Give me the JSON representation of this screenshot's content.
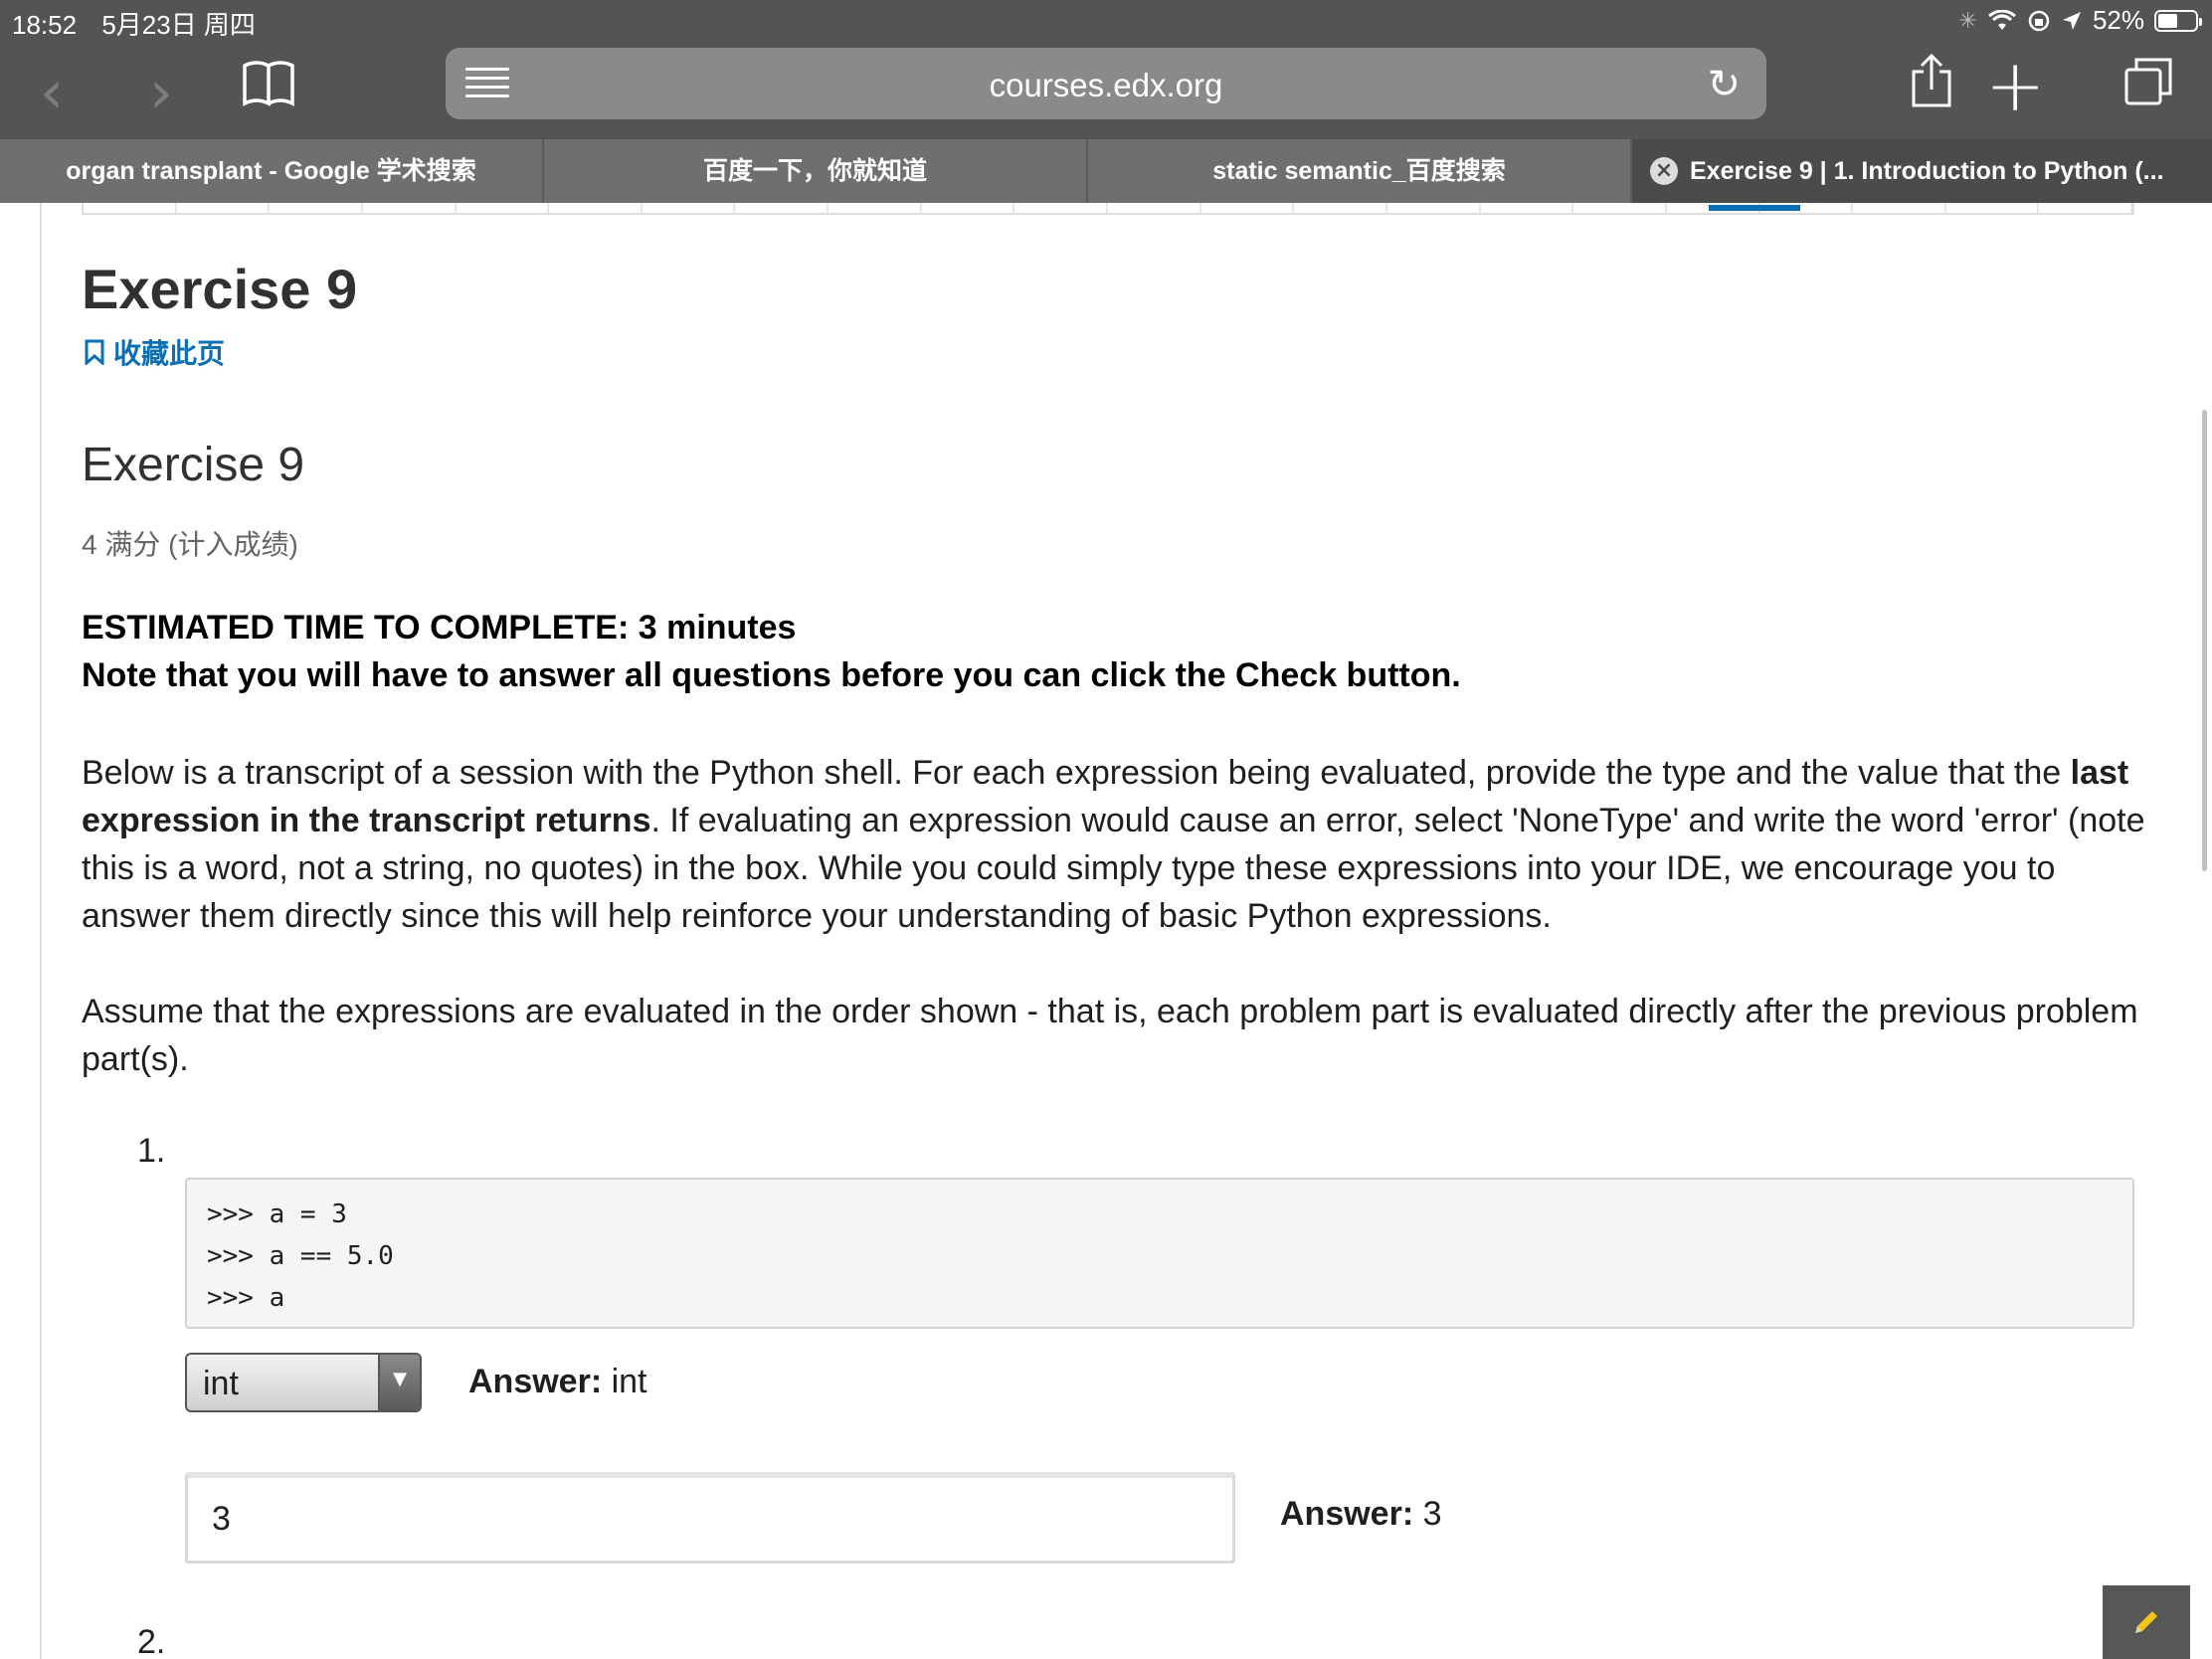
{
  "status": {
    "time": "18:52",
    "date": "5月23日 周四",
    "battery": "52%",
    "battery_level": 0.52
  },
  "browser": {
    "url": "courses.edx.org",
    "tabs": [
      {
        "label": "organ transplant - Google 学术搜索"
      },
      {
        "label": "百度一下，你就知道"
      },
      {
        "label": "static semantic_百度搜索"
      },
      {
        "label": "Exercise 9 | 1. Introduction to Python (..."
      }
    ]
  },
  "page": {
    "title": "Exercise 9",
    "bookmark_label": "收藏此页",
    "problem_title": "Exercise 9",
    "points": "4 满分 (计入成绩)",
    "estimated_time": "ESTIMATED TIME TO COMPLETE: 3 minutes",
    "note": "Note that you will have to answer all questions before you can click the Check button.",
    "intro_before": "Below is a transcript of a session with the Python shell. For each expression being evaluated, provide the type and the value that the ",
    "intro_bold": "last expression in the transcript returns",
    "intro_after": ". If evaluating an expression would cause an error, select 'NoneType' and write the word 'error' (note this is a word, not a string, no quotes) in the box. While you could simply type these expressions into your IDE, we encourage you to answer them directly since this will help reinforce your understanding of basic Python expressions.",
    "assume": "Assume that the expressions are evaluated in the order shown - that is, each problem part is evaluated directly after the previous problem part(s).",
    "questions": [
      {
        "number": "1.",
        "code": ">>> a = 3\n>>> a == 5.0\n>>> a",
        "type_selected": "int",
        "type_answer_label": "Answer:",
        "type_answer": "int",
        "value_input": "3",
        "value_answer_label": "Answer:",
        "value_answer": "3"
      },
      {
        "number": "2."
      }
    ]
  },
  "colors": {
    "accent": "#0a6fb4",
    "chrome": "#545454",
    "tabbar": "#6f6f6f"
  }
}
